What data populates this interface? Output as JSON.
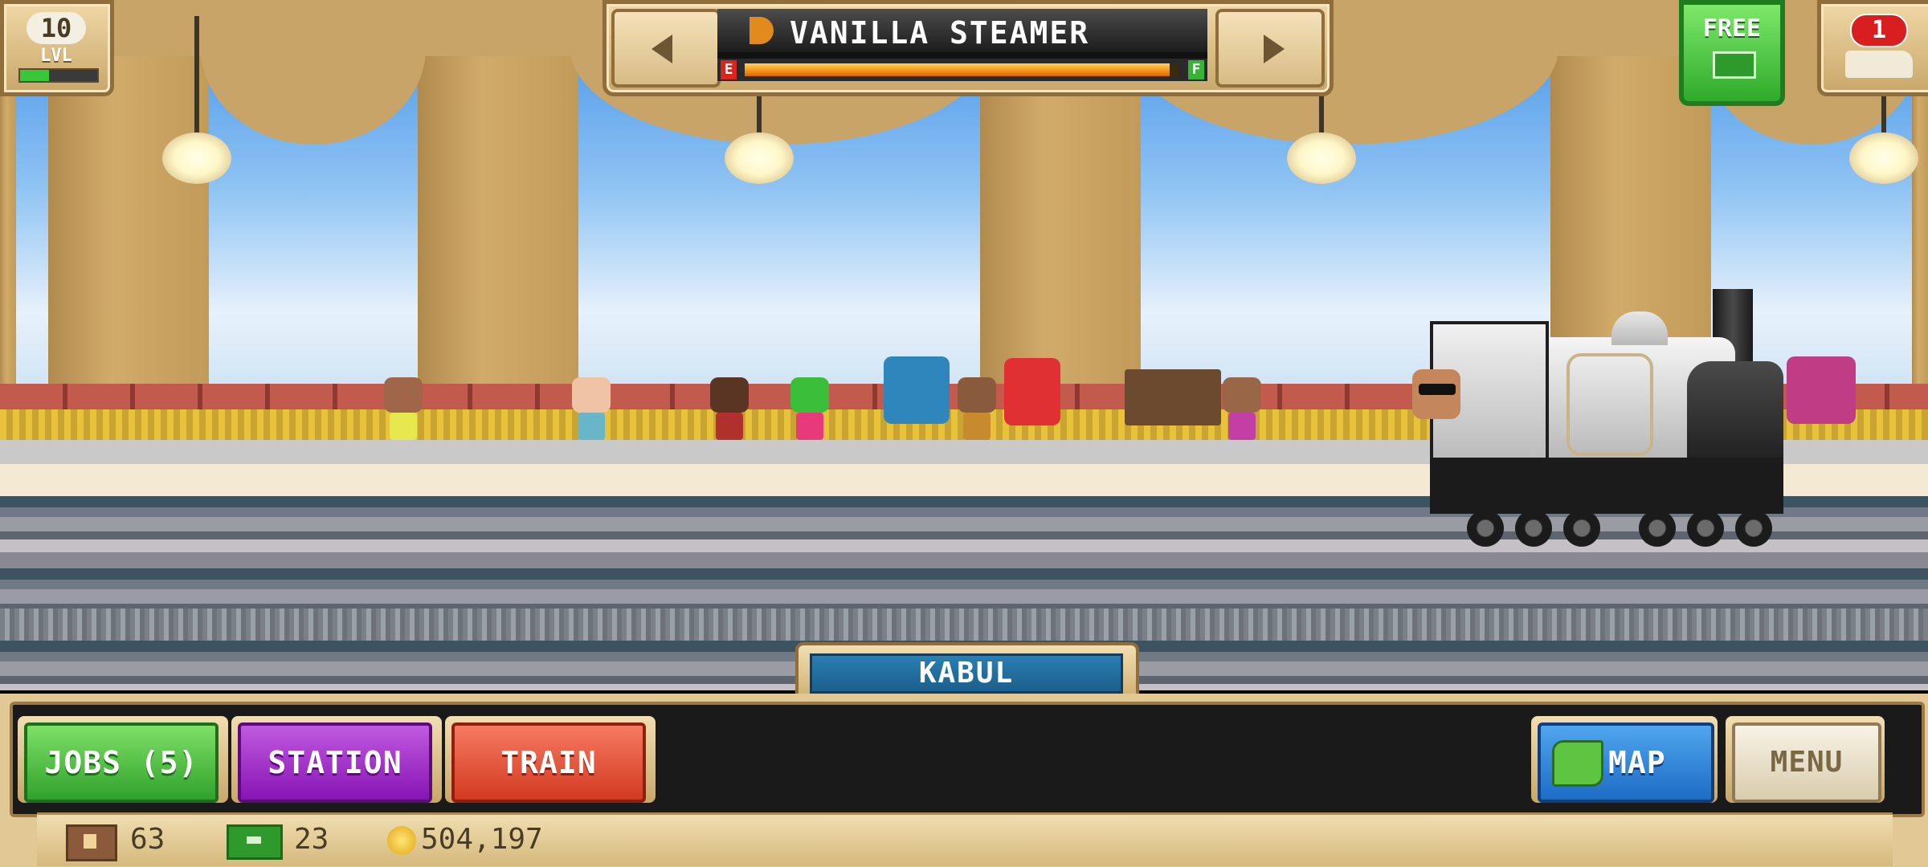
{
  "hud": {
    "level": "10",
    "level_label": "LVL",
    "xp_progress": 0.38,
    "train_name": "VANILLA STEAMER",
    "fuel_empty_label": "E",
    "fuel_full_label": "F",
    "fuel_level": 0.98,
    "free_label": "FREE",
    "depot_badge_count": "1"
  },
  "station": {
    "name": "KABUL"
  },
  "buttons": {
    "jobs": "JOBS (5)",
    "station": "STATION",
    "train": "TRAIN",
    "map": "MAP",
    "menu": "MENU"
  },
  "resources": {
    "crates": "63",
    "cash": "23",
    "coins": "504,197"
  },
  "colors": {
    "jobs_button": "#4cc43c",
    "station_button": "#a22fd0",
    "train_button": "#e0553a",
    "map_button": "#2f86de",
    "station_tag": "#1f6e9f",
    "fuel_bar": "#f59014"
  },
  "icons": {
    "prev": "arrow-left-icon",
    "next": "arrow-right-icon",
    "train": "train-icon",
    "crate": "crate-icon",
    "cash": "cash-icon",
    "coin": "coin-icon",
    "map": "map-icon"
  }
}
